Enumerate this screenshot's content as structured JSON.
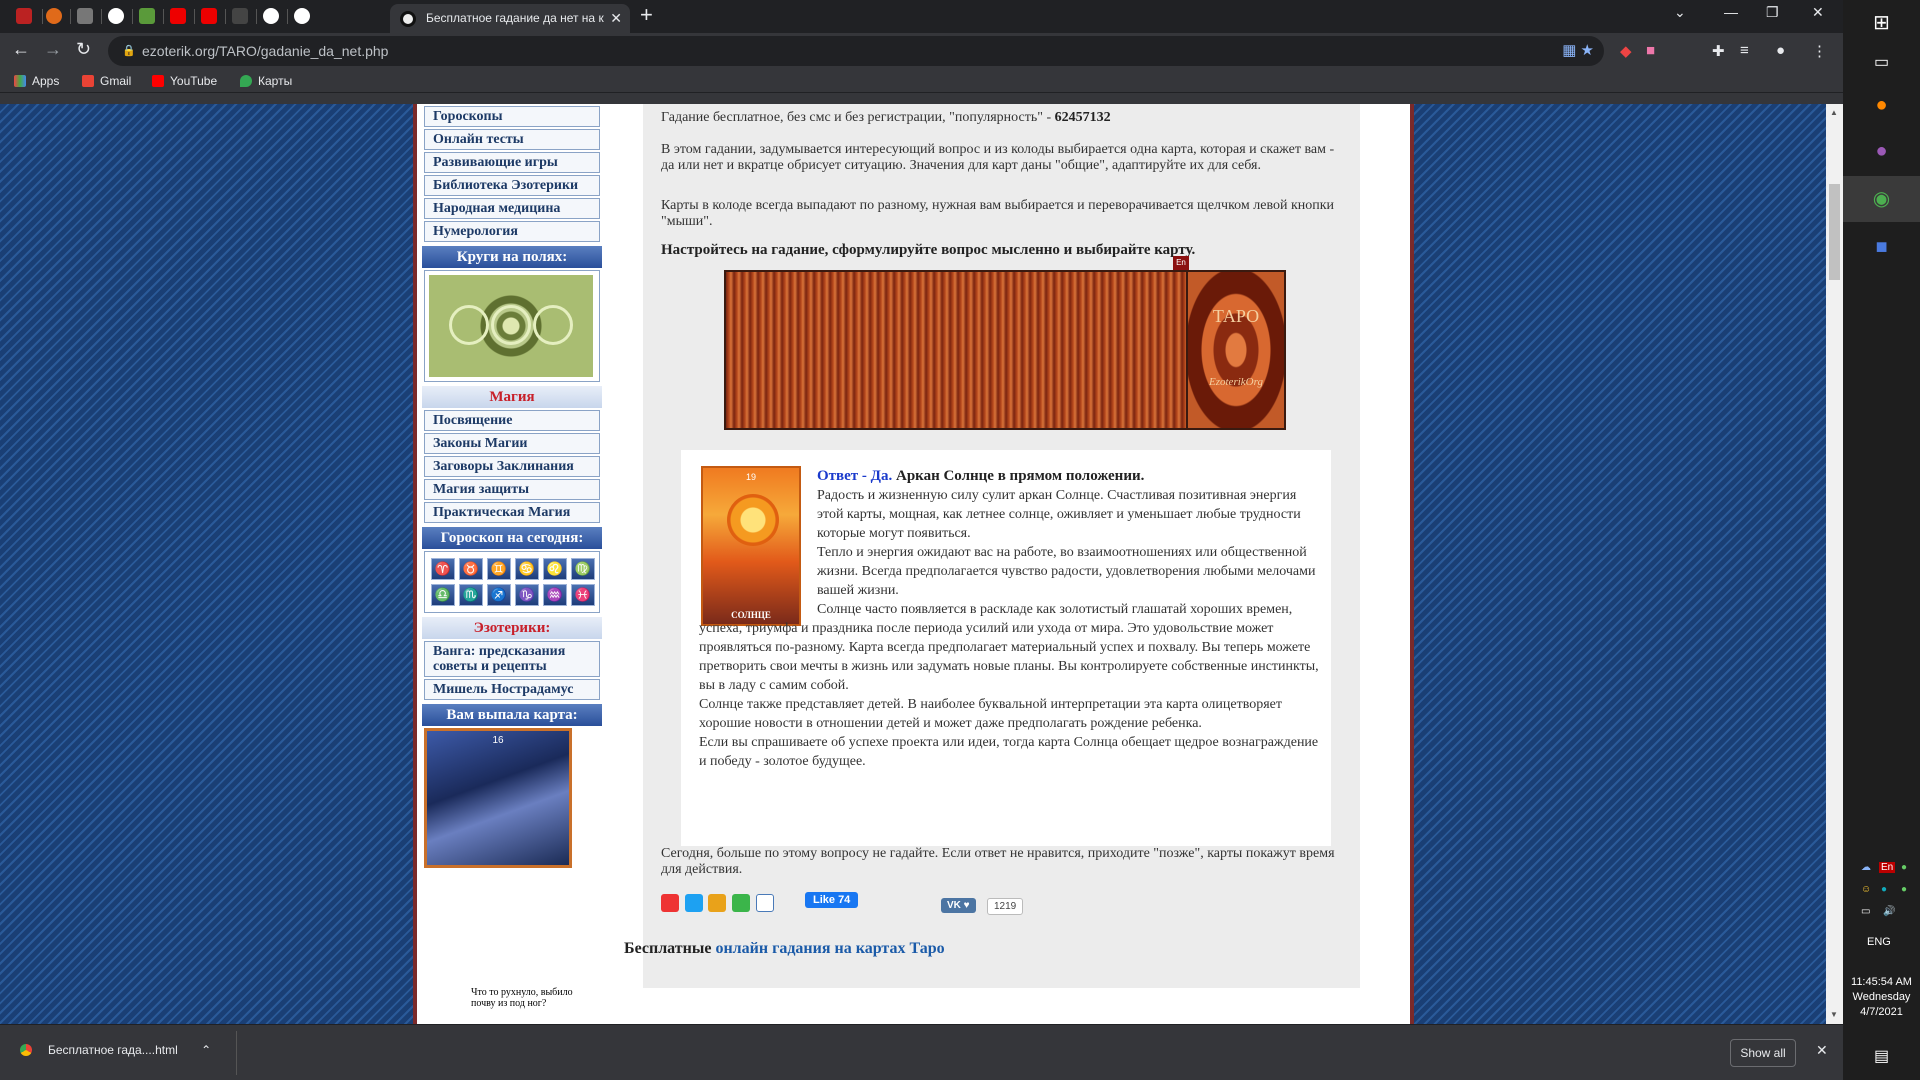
{
  "browser": {
    "active_tab_title": "Бесплатное гадание да нет на к",
    "url": "ezoterik.org/TARO/gadanie_da_net.php",
    "bookmarks": [
      "Apps",
      "Gmail",
      "YouTube",
      "Карты"
    ]
  },
  "sidebar": {
    "menu_top": [
      "Гороскопы",
      "Онлайн тесты",
      "Развивающие игры",
      "Библиотека Эзотерики",
      "Народная медицина",
      "Нумерология"
    ],
    "crop_header": "Круги на полях:",
    "magic_header": "Магия",
    "menu_magic": [
      "Посвящение",
      "Законы Магии",
      "Заговоры Заклинания",
      "Магия защиты",
      "Практическая Магия"
    ],
    "horoscope_header": "Гороскоп на сегодня:",
    "zodiac": [
      "♈",
      "♉",
      "♊",
      "♋",
      "♌",
      "♍",
      "♎",
      "♏",
      "♐",
      "♑",
      "♒",
      "♓"
    ],
    "esoteric_header": "Эзотерики:",
    "menu_esoteric": [
      "Ванга: предсказания советы и рецепты",
      "Мишель Нострадамус"
    ],
    "card_header": "Вам выпала карта:",
    "card_number": "16",
    "card_caption": "Что то рухнуло, выбило почву из под ног?"
  },
  "main": {
    "intro_text": "Гадание бесплатное, без смс и без регистрации, \"популярность\" - ",
    "popularity": "62457132",
    "para1": "В этом гадании, задумывается интересующий вопрос и из колоды выбирается одна карта, которая и скажет вам - да или нет и вкратце обрисует ситуацию. Значения для карт даны \"общие\", адаптируйте их для себя.",
    "para2": "Карты в колоде всегда выпадают по разному, нужная вам выбирается и переворачивается щелчком левой кнопки \"мыши\".",
    "instruction": "Настройтесь на гадание, сформулируйте вопрос мысленно и выбирайте карту.",
    "deck_title": "ТАРО",
    "deck_sub": "EzoterikOrg",
    "en_badge": "En",
    "answer": {
      "card_number": "19",
      "card_name": "СОЛНЦЕ",
      "yes_label": "Ответ - Да.",
      "heading": " Аркан Солнце в прямом положении.",
      "p1": "Радость и жизненную силу сулит аркан Солнце. Счастливая позитивная энергия этой карты, мощная, как летнее солнце, оживляет и уменьшает любые трудности которые могут появиться.",
      "p2": "Тепло и энергия ожидают вас на работе, во взаимоотношениях или общественной жизни. Всегда предполагается чувство радости, удовлетворения любыми мелочами вашей жизни.",
      "p3": "Солнце часто появляется в раскладе как золотистый глашатай хороших времен, успеха, триумфа и праздника после периода усилий или ухода от мира. Это удовольствие может проявляться по-разному. Карта всегда предполагает материальный успех и похвалу. Вы теперь можете претворить свои мечты в жизнь или задумать новые планы. Вы контролируете собственные инстинкты, вы в ладу с самим собой.",
      "p4": "Солнце также представляет детей. В наиболее буквальной интерпретации эта карта олицетворяет хорошие новости в отношении детей и может даже предполагать рождение ребенка.",
      "p5": "Если вы спрашиваете об успехе проекта или идеи, тогда карта Солнца обещает щедрое вознаграждение и победу - золотое будущее."
    },
    "closing": "Сегодня, больше по этому вопросу не гадайте. Если ответ не нравится, приходите \"позже\", карты покажут время для действия.",
    "fb_like": "Like 74",
    "vk_count": "1219",
    "bottom_prefix": "Бесплатные ",
    "bottom_link": "онлайн гадания на картах Таро"
  },
  "downloads": {
    "file": "Бесплатное гада....html",
    "show_all": "Show all"
  },
  "taskbar": {
    "lang": "ENG",
    "time": "11:45:54 AM",
    "day": "Wednesday",
    "date": "4/7/2021",
    "tray_lang": "En"
  }
}
